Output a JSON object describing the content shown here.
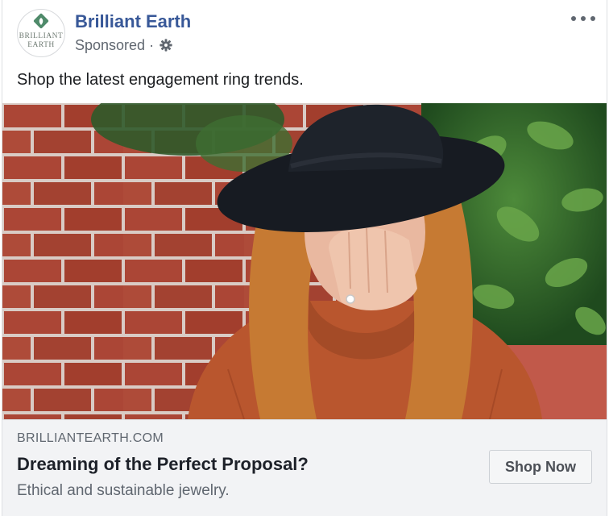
{
  "post": {
    "page_name": "Brilliant Earth",
    "sponsored_label": "Sponsored",
    "separator": "·",
    "privacy_icon": "gear-icon",
    "more_icon": "more-options-icon",
    "caption": "Shop the latest engagement ring trends."
  },
  "avatar": {
    "logo_line1": "BRILLIANT",
    "logo_line2": "EARTH",
    "leaf_color": "#4f8a6a"
  },
  "media": {
    "subject": "woman in black wide-brim hat and rust sweater covering smile with hand showing engagement ring, brick steps and green leaves behind"
  },
  "link_preview": {
    "domain": "BRILLIANTEARTH.COM",
    "headline": "Dreaming of the Perfect Proposal?",
    "description": "Ethical and sustainable jewelry.",
    "cta_label": "Shop Now"
  },
  "colors": {
    "page_name": "#385898",
    "secondary_text": "#606770",
    "footer_bg": "#f2f3f5"
  }
}
